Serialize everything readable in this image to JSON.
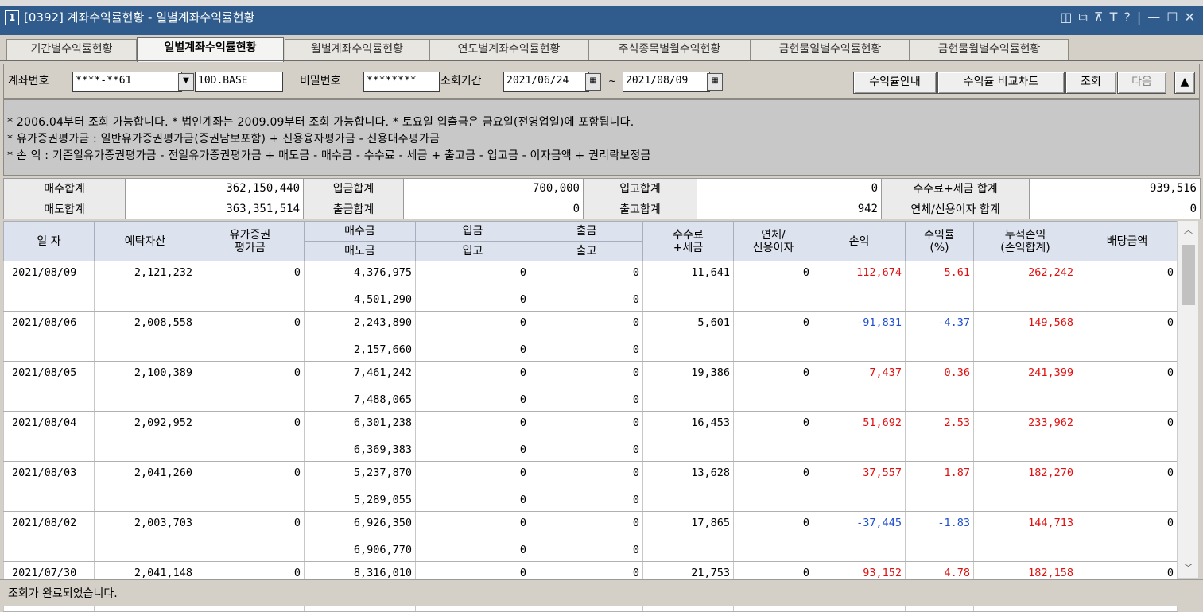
{
  "window": {
    "number": "1",
    "title": "[0392] 계좌수익률현황 - 일별계좌수익률현황",
    "buttons": [
      "◫",
      "⧉",
      "⊼",
      "T",
      "?",
      "|",
      "—",
      "☐",
      "✕"
    ]
  },
  "tabs": [
    {
      "label": "기간별수익률현황",
      "active": false
    },
    {
      "label": "일별계좌수익률현황",
      "active": true
    },
    {
      "label": "월별계좌수익률현황",
      "active": false
    },
    {
      "label": "연도별계좌수익률현황",
      "active": false
    },
    {
      "label": "주식종목별월수익현황",
      "active": false
    },
    {
      "label": "금현물일별수익률현황",
      "active": false
    },
    {
      "label": "금현물월별수익률현황",
      "active": false
    }
  ],
  "search": {
    "account_label": "계좌번호",
    "account_value": "****-**61",
    "account_name": "10D.BASE",
    "password_label": "비밀번호",
    "password_value": "********",
    "period_label": "조회기간",
    "date_from": "2021/06/24",
    "tilde": "~",
    "date_to": "2021/08/09",
    "guide_btn": "수익률안내",
    "compare_btn": "수익률 비교차트",
    "query_btn": "조회",
    "next_btn": "다음",
    "collapse_btn": "▲"
  },
  "notice": [
    "* 2006.04부터 조회 가능합니다.  * 법인계좌는 2009.09부터 조회 가능합니다.  * 토요일 입출금은 금요일(전영업일)에 포함됩니다.",
    "* 유가증권평가금 : 일반유가증권평가금(증권담보포함) + 신용융자평가금 - 신용대주평가금",
    "* 손       익 : 기준일유가증권평가금 - 전일유가증권평가금 + 매도금 - 매수금 - 수수료 - 세금 + 출고금 - 입고금 - 이자금액 + 권리락보정금"
  ],
  "summary": {
    "row1": [
      {
        "label": "매수합계",
        "value": "362,150,440"
      },
      {
        "label": "입금합계",
        "value": "700,000"
      },
      {
        "label": "입고합계",
        "value": "0"
      },
      {
        "label": "수수료+세금 합계",
        "value": "939,516"
      }
    ],
    "row2": [
      {
        "label": "매도합계",
        "value": "363,351,514"
      },
      {
        "label": "출금합계",
        "value": "0"
      },
      {
        "label": "출고합계",
        "value": "942"
      },
      {
        "label": "연체/신용이자 합계",
        "value": "0"
      }
    ]
  },
  "grid": {
    "headers": {
      "date": "일 자",
      "deposit_asset": "예탁자산",
      "securities_line1": "유가증권",
      "securities_line2": "평가금",
      "buy": "매수금",
      "sell": "매도금",
      "deposit_in": "입금",
      "stock_in": "입고",
      "withdraw": "출금",
      "stock_out": "출고",
      "fee_line1": "수수료",
      "fee_line2": "+세금",
      "interest_line1": "연체/",
      "interest_line2": "신용이자",
      "pnl": "손익",
      "rate_line1": "수익률",
      "rate_line2": "(%)",
      "cum_line1": "누적손익",
      "cum_line2": "(손익합계)",
      "dividend": "배당금액"
    },
    "rows": [
      {
        "date": "2021/08/09",
        "asset": "2,121,232",
        "sec": "0",
        "buy": "4,376,975",
        "sell": "4,501,290",
        "din": "0",
        "sin": "0",
        "dout": "0",
        "sout": "0",
        "fee": "11,641",
        "interest": "0",
        "pnl": "112,674",
        "rate": "5.61",
        "cum": "262,242",
        "div": "0",
        "sign": "pos"
      },
      {
        "date": "2021/08/06",
        "asset": "2,008,558",
        "sec": "0",
        "buy": "2,243,890",
        "sell": "2,157,660",
        "din": "0",
        "sin": "0",
        "dout": "0",
        "sout": "0",
        "fee": "5,601",
        "interest": "0",
        "pnl": "-91,831",
        "rate": "-4.37",
        "cum": "149,568",
        "div": "0",
        "sign": "neg"
      },
      {
        "date": "2021/08/05",
        "asset": "2,100,389",
        "sec": "0",
        "buy": "7,461,242",
        "sell": "7,488,065",
        "din": "0",
        "sin": "0",
        "dout": "0",
        "sout": "0",
        "fee": "19,386",
        "interest": "0",
        "pnl": "7,437",
        "rate": "0.36",
        "cum": "241,399",
        "div": "0",
        "sign": "pos"
      },
      {
        "date": "2021/08/04",
        "asset": "2,092,952",
        "sec": "0",
        "buy": "6,301,238",
        "sell": "6,369,383",
        "din": "0",
        "sin": "0",
        "dout": "0",
        "sout": "0",
        "fee": "16,453",
        "interest": "0",
        "pnl": "51,692",
        "rate": "2.53",
        "cum": "233,962",
        "div": "0",
        "sign": "pos"
      },
      {
        "date": "2021/08/03",
        "asset": "2,041,260",
        "sec": "0",
        "buy": "5,237,870",
        "sell": "5,289,055",
        "din": "0",
        "sin": "0",
        "dout": "0",
        "sout": "0",
        "fee": "13,628",
        "interest": "0",
        "pnl": "37,557",
        "rate": "1.87",
        "cum": "182,270",
        "div": "0",
        "sign": "pos"
      },
      {
        "date": "2021/08/02",
        "asset": "2,003,703",
        "sec": "0",
        "buy": "6,926,350",
        "sell": "6,906,770",
        "din": "0",
        "sin": "0",
        "dout": "0",
        "sout": "0",
        "fee": "17,865",
        "interest": "0",
        "pnl": "-37,445",
        "rate": "-1.83",
        "cum": "144,713",
        "div": "0",
        "sign": "neg"
      },
      {
        "date": "2021/07/30",
        "asset": "2,041,148",
        "sec": "0",
        "buy": "8,316,010",
        "sell": "",
        "din": "0",
        "sin": "",
        "dout": "0",
        "sout": "",
        "fee": "21,753",
        "interest": "0",
        "pnl": "93,152",
        "rate": "4.78",
        "cum": "182,158",
        "div": "0",
        "sign": "pos"
      }
    ]
  },
  "status": "조회가 완료되었습니다.",
  "colors": {
    "titlebar": "#2f5c8c",
    "positive": "#e01010",
    "negative": "#1f4ed2",
    "header_bg": "#dde3ee"
  }
}
